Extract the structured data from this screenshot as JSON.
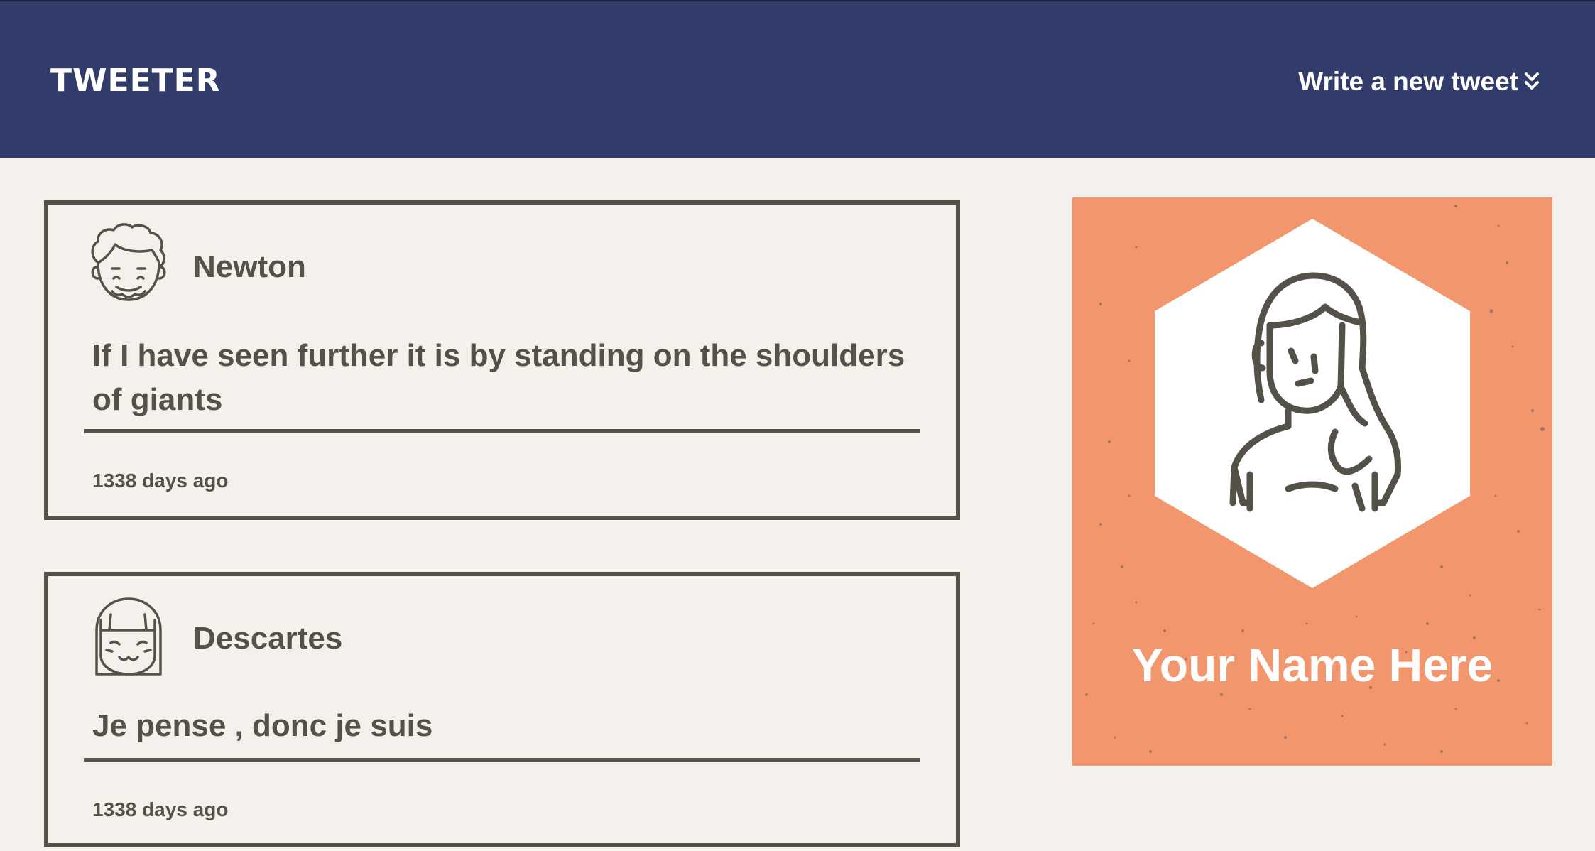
{
  "header": {
    "brand": "TWEETER",
    "compose_label": "Write a new tweet",
    "compose_icon": "double-chevron-down-icon"
  },
  "tweets": [
    {
      "author": "Newton",
      "avatar_icon": "curly-hair-face-icon",
      "text": "If I have seen further it is by standing on the shoulders of giants",
      "timestamp": "1338 days ago"
    },
    {
      "author": "Descartes",
      "avatar_icon": "bob-hair-face-icon",
      "text": "Je pense , donc je suis",
      "timestamp": "1338 days ago"
    }
  ],
  "profile": {
    "name": "Your Name Here",
    "avatar_icon": "woman-portrait-icon",
    "background_color": "#f2976d"
  },
  "colors": {
    "header_bg": "#313c6a",
    "page_bg": "#f4f1ec",
    "ink": "#545149",
    "profile_bg": "#f2976d"
  }
}
